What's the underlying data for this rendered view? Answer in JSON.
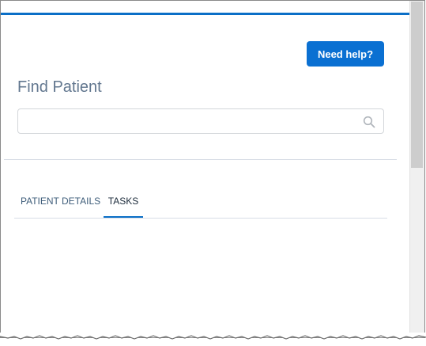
{
  "header": {
    "help_button_label": "Need help?"
  },
  "main": {
    "title": "Find Patient",
    "search": {
      "value": "",
      "placeholder": ""
    },
    "tabs": [
      {
        "label": "PATIENT DETAILS",
        "active": false
      },
      {
        "label": "TASKS",
        "active": true
      }
    ]
  },
  "icons": {
    "search": "search-icon"
  },
  "colors": {
    "accent": "#0b6fc7",
    "button": "#0a70d2",
    "title_text": "#62778f",
    "tab_text": "#3e5d7a"
  }
}
